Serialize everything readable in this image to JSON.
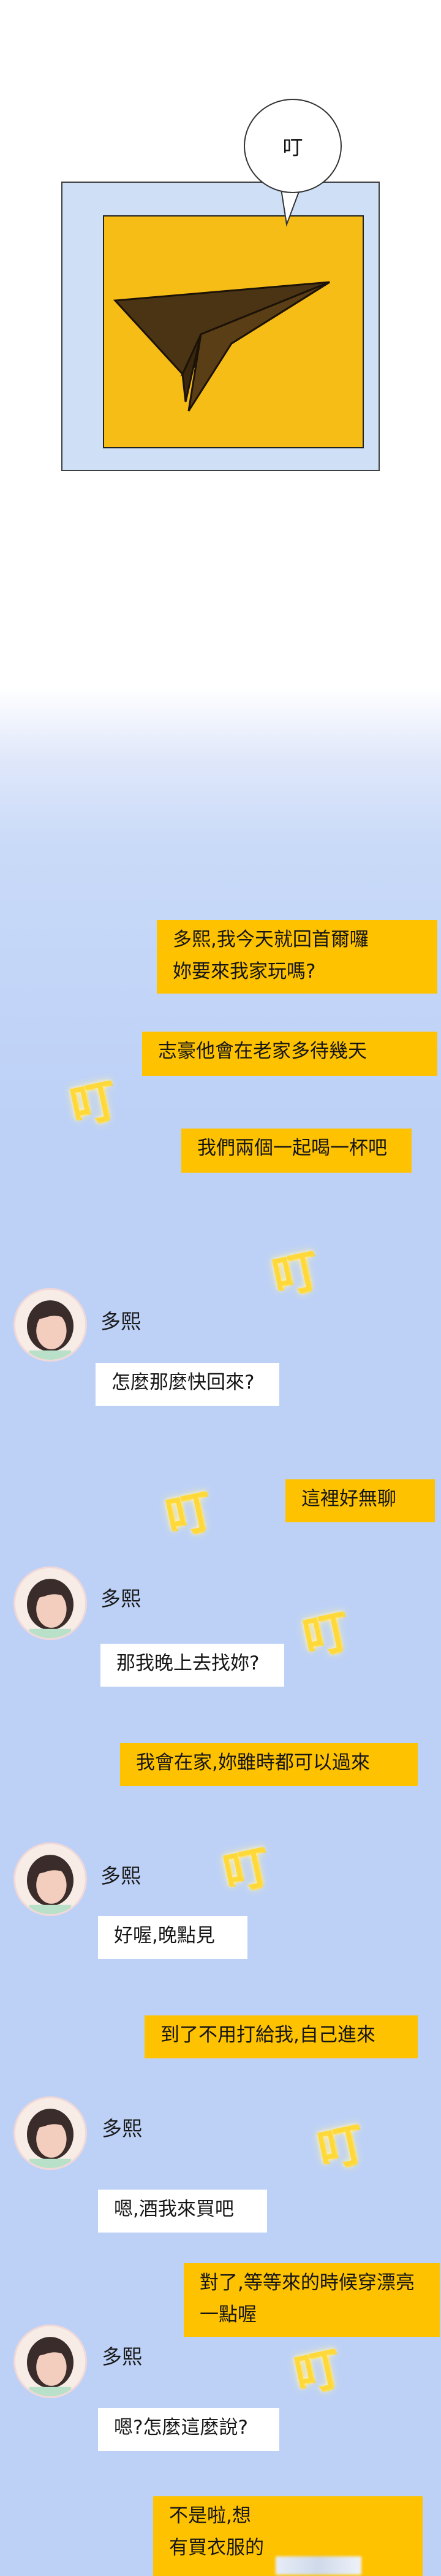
{
  "panel1": {
    "sound_text": "叮"
  },
  "chat": {
    "sender_name": "多熙",
    "sfx": "叮",
    "messages": [
      {
        "side": "right",
        "text": "多熙,我今天就回首爾囉\n妳要來我家玩嗎?"
      },
      {
        "side": "right",
        "text": "志豪他會在老家多待幾天"
      },
      {
        "side": "right",
        "text": "我們兩個一起喝一杯吧"
      },
      {
        "side": "left",
        "text": "怎麼那麼快回來?"
      },
      {
        "side": "right",
        "text": "這裡好無聊"
      },
      {
        "side": "left",
        "text": "那我晚上去找妳?"
      },
      {
        "side": "right",
        "text": "我會在家,妳雖時都可以過來"
      },
      {
        "side": "left",
        "text": "好喔,晚點見"
      },
      {
        "side": "right",
        "text": "到了不用打給我,自己進來"
      },
      {
        "side": "left",
        "text": "嗯,酒我來買吧"
      },
      {
        "side": "right",
        "text": "對了,等等來的時候穿漂亮\n一點喔"
      },
      {
        "side": "left",
        "text": "嗯?怎麼這麼說?"
      },
      {
        "side": "right",
        "text": "不是啦,想\n有買衣服的"
      }
    ]
  },
  "colors": {
    "panel_yellow": "#f6bd16",
    "panel_frame": "#cfe0f6",
    "chat_background": "#bdd1f7",
    "outgoing_bubble": "#fec200",
    "incoming_bubble": "#ffffff",
    "plane": "#4a3414"
  },
  "icons": [
    "paper-plane-icon",
    "avatar-portrait"
  ]
}
